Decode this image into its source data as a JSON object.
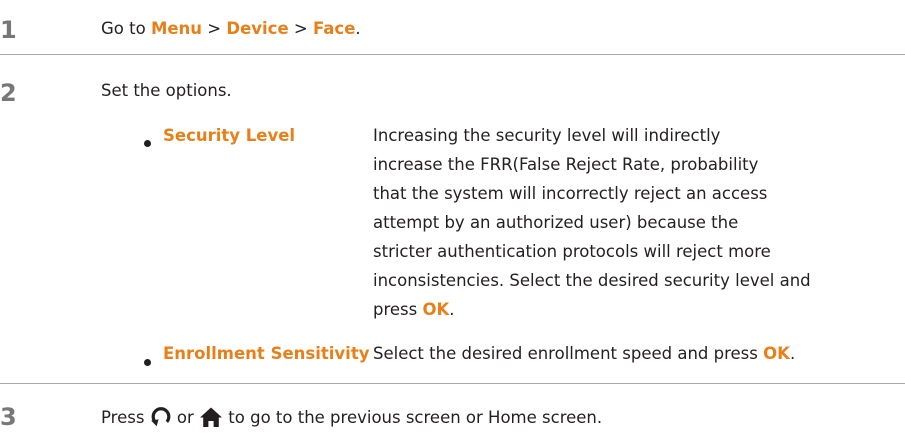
{
  "steps": [
    {
      "number": "1",
      "parts": {
        "prefix": "Go to ",
        "menu": "Menu",
        "sep1": " > ",
        "device": "Device",
        "sep2": " > ",
        "face": "Face",
        "suffix": "."
      }
    },
    {
      "number": "2",
      "text": "Set the options."
    },
    {
      "number": "3",
      "parts": {
        "prefix": "Press ",
        "middle": " or ",
        "suffix": " to go to the previous screen or Home screen."
      }
    }
  ],
  "options": [
    {
      "name": "Security Level",
      "lines": [
        "Increasing the security level will indirectly",
        "increase the FRR(False Reject Rate, probability",
        "that the system will incorrectly reject an access",
        "attempt by an authorized user) because the",
        "stricter authentication protocols will reject more",
        "inconsistencies. Select the desired security level and"
      ],
      "last_line_prefix": "press ",
      "ok": "OK",
      "last_line_suffix": "."
    },
    {
      "name": "Enrollment Sensitivity",
      "desc_prefix": "Select the desired enrollment speed and press ",
      "ok": "OK",
      "desc_suffix": "."
    }
  ],
  "icons": {
    "back": "back-arrow-icon",
    "home": "home-icon"
  },
  "colors": {
    "accent": "#e8801a",
    "text": "#231f20",
    "step_number": "#777777",
    "rule": "#a8a8a8"
  }
}
